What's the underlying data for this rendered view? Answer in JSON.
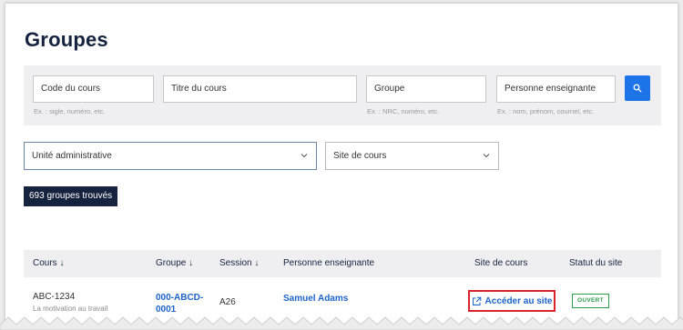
{
  "page": {
    "title": "Groupes"
  },
  "filters": {
    "course_code": {
      "label": "Code du cours",
      "hint": "Ex. : sigle, numéro, etc."
    },
    "course_title": {
      "label": "Titre du cours"
    },
    "group": {
      "label": "Groupe",
      "hint": "Ex. : NRC, numéro, etc."
    },
    "teacher": {
      "label": "Personne enseignante",
      "hint": "Ex. : nom, prénom, courriel, etc."
    },
    "search_icon": "search-icon",
    "admin_unit": {
      "label": "Unité administrative"
    },
    "course_site": {
      "label": "Site de cours"
    }
  },
  "results": {
    "count_label": "693 groupes trouvés"
  },
  "table": {
    "headers": {
      "course": "Cours ↓",
      "group": "Groupe ↓",
      "session": "Session ↓",
      "teacher": "Personne enseignante",
      "site": "Site de cours",
      "status": "Statut du site"
    },
    "rows": [
      {
        "course_code": "ABC-1234",
        "course_title": "La motivation au travail",
        "group_line1": "000-ABCD-",
        "group_line2": "0001",
        "session": "A26",
        "teacher": "Samuel Adams",
        "site_link": "Accéder au site",
        "status": "OUVERT"
      }
    ]
  },
  "colors": {
    "accent": "#1d73e8",
    "dark": "#15233f",
    "link": "#1d63c9",
    "highlight": "#d9242e",
    "open": "#2a9d4b"
  }
}
